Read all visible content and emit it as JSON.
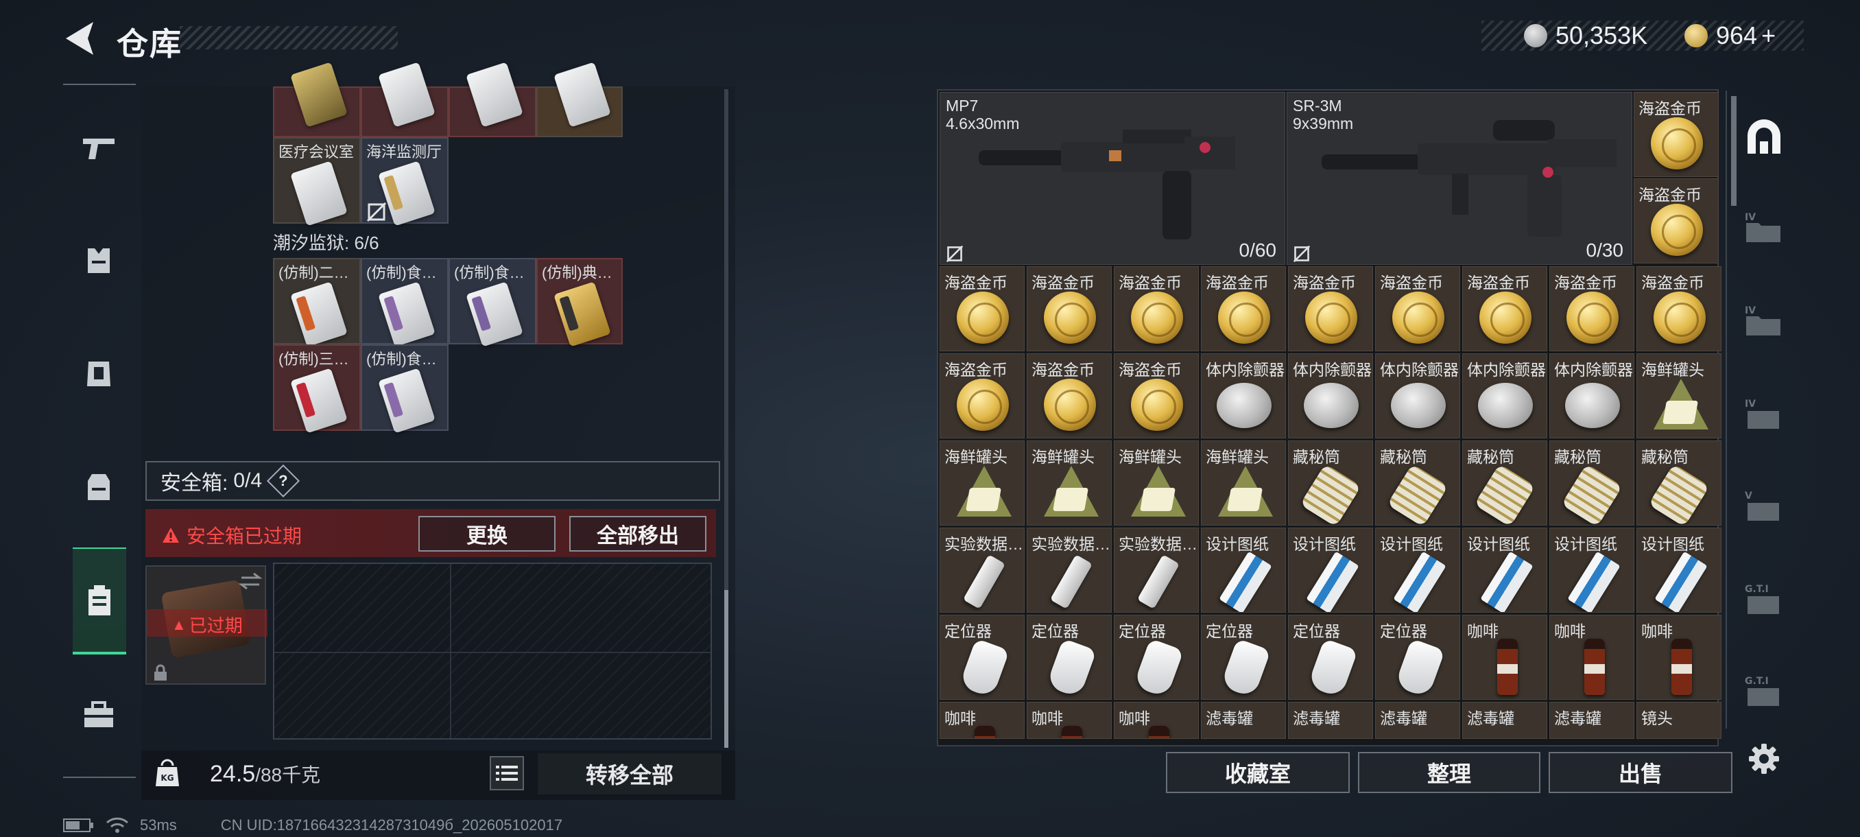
{
  "header": {
    "title": "仓库",
    "back_icon": "back-arrow-icon"
  },
  "currency": {
    "coins": "50,353K",
    "premium": "964",
    "plus": "+"
  },
  "nav": [
    {
      "name": "weapons",
      "icon": "gun-icon"
    },
    {
      "name": "armor",
      "icon": "vest-icon"
    },
    {
      "name": "chest-rig",
      "icon": "rig-icon"
    },
    {
      "name": "backpack",
      "icon": "backpack-icon"
    },
    {
      "name": "safe-box",
      "icon": "case-icon",
      "active": true
    },
    {
      "name": "toolbox",
      "icon": "toolbox-icon"
    }
  ],
  "left": {
    "row_top_labels": [
      "",
      "",
      "",
      ""
    ],
    "cards_row2": [
      {
        "label": "医疗会议室",
        "color": "brown"
      },
      {
        "label": "海洋监测厅",
        "color": "blue"
      }
    ],
    "prison_label": "潮汐监狱: 6/6",
    "prison_cards": [
      {
        "label": "(仿制)二…",
        "color": "brown"
      },
      {
        "label": "(仿制)食…",
        "color": "blue"
      },
      {
        "label": "(仿制)食…",
        "color": "blue"
      },
      {
        "label": "(仿制)典…",
        "color": "red"
      },
      {
        "label": "(仿制)三…",
        "color": "red"
      },
      {
        "label": "(仿制)食…",
        "color": "blue"
      }
    ],
    "safe_label": "安全箱:",
    "safe_count": "0/4",
    "help": "?",
    "expired_warning": "安全箱已过期",
    "replace_button": "更换",
    "move_all_out_button": "全部移出",
    "expired_badge": "已过期",
    "weight_value": "24.5",
    "weight_max": "/88千克",
    "transfer_all_button": "转移全部"
  },
  "right": {
    "weapons": [
      {
        "name": "MP7",
        "caliber": "4.6x30mm",
        "ammo": "0/60"
      },
      {
        "name": "SR-3M",
        "caliber": "9x39mm",
        "ammo": "0/30"
      }
    ],
    "side_items": [
      "海盗金币",
      "海盗金币"
    ],
    "rows": [
      [
        "海盗金币",
        "海盗金币",
        "海盗金币",
        "海盗金币",
        "海盗金币",
        "海盗金币",
        "海盗金币",
        "海盗金币",
        "海盗金币"
      ],
      [
        "海盗金币",
        "海盗金币",
        "海盗金币",
        "体内除颤器",
        "体内除颤器",
        "体内除颤器",
        "体内除颤器",
        "体内除颤器",
        "海鲜罐头"
      ],
      [
        "海鲜罐头",
        "海鲜罐头",
        "海鲜罐头",
        "海鲜罐头",
        "藏秘筒",
        "藏秘筒",
        "藏秘筒",
        "藏秘筒",
        "藏秘筒"
      ],
      [
        "实验数据…",
        "实验数据…",
        "实验数据…",
        "设计图纸",
        "设计图纸",
        "设计图纸",
        "设计图纸",
        "设计图纸",
        "设计图纸"
      ],
      [
        "定位器",
        "定位器",
        "定位器",
        "定位器",
        "定位器",
        "定位器",
        "咖啡",
        "咖啡",
        "咖啡"
      ],
      [
        "咖啡",
        "咖啡",
        "咖啡",
        "滤毒罐",
        "滤毒罐",
        "滤毒罐",
        "滤毒罐",
        "滤毒罐",
        "镜头"
      ]
    ],
    "collection_button": "收藏室",
    "sort_button": "整理",
    "sell_button": "出售"
  },
  "right_sidebar": [
    "ring-icon",
    "iv-icon",
    "iv-icon",
    "iv-icon",
    "v-icon",
    "gti-icon",
    "gti-icon",
    "settings-icon"
  ],
  "status": {
    "ping": "53ms",
    "uid": "CN UID:18716643231428731049б_202605102017"
  }
}
